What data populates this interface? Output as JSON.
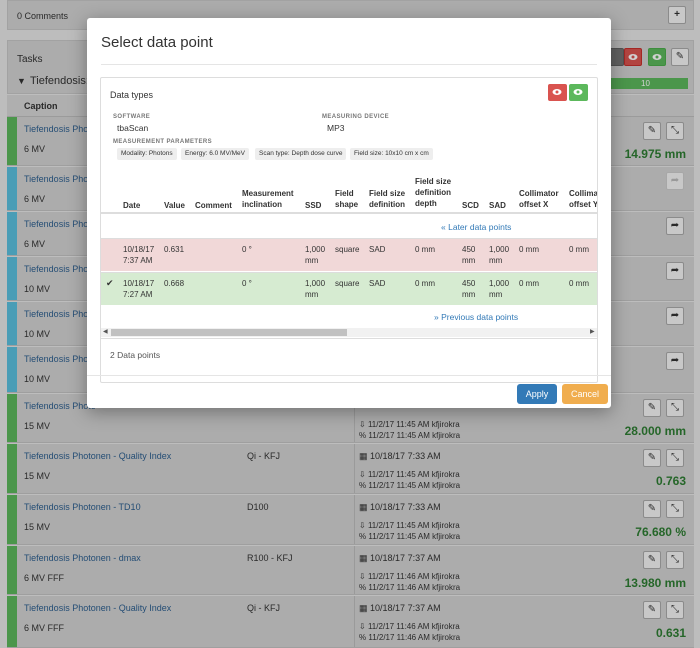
{
  "comments": {
    "count_label": "0 Comments",
    "add_icon": "+"
  },
  "tasks": {
    "title": "Tasks",
    "group_title": "Tiefendosis:",
    "caption_header": "Caption",
    "progress_value": "10",
    "colors": {
      "measured": "#5cb85c",
      "pending": "#5bc0de",
      "danger": "#d9534f",
      "link": "#2d5f8f",
      "value": "#2e7d32"
    }
  },
  "rows": [
    {
      "caption": "Tiefendosis Photo",
      "energy": "6 MV",
      "measurement": "",
      "date": "",
      "uploaded": "",
      "checked": "",
      "value": "14.975 mm",
      "action": "edit"
    },
    {
      "caption": "Tiefendosis Photo",
      "energy": "6 MV",
      "measurement": "",
      "date": "",
      "uploaded": "",
      "checked": "",
      "value": "",
      "action": "share-disabled"
    },
    {
      "caption": "Tiefendosis Photo",
      "energy": "6 MV",
      "measurement": "",
      "date": "",
      "uploaded": "",
      "checked": "",
      "value": "",
      "action": "share"
    },
    {
      "caption": "Tiefendosis Photo",
      "energy": "10 MV",
      "measurement": "",
      "date": "",
      "uploaded": "",
      "checked": "",
      "value": "",
      "action": "share"
    },
    {
      "caption": "Tiefendosis Photo",
      "energy": "10 MV",
      "measurement": "",
      "date": "",
      "uploaded": "",
      "checked": "",
      "value": "",
      "action": "share"
    },
    {
      "caption": "Tiefendosis Photo",
      "energy": "10 MV",
      "measurement": "",
      "date": "",
      "uploaded": "",
      "checked": "",
      "value": "",
      "action": "share"
    },
    {
      "caption": "Tiefendosis Photo",
      "energy": "15 MV",
      "measurement": "",
      "date": "",
      "uploaded": "11/2/17 11:45 AM kfjirokra",
      "checked": "11/2/17 11:45 AM kfjirokra",
      "value": "28.000 mm",
      "action": "edit"
    },
    {
      "caption": "Tiefendosis Photonen - Quality Index",
      "energy": "15 MV",
      "measurement": "Qi - KFJ",
      "date": "10/18/17 7:33 AM",
      "uploaded": "11/2/17 11:45 AM kfjirokra",
      "checked": "11/2/17 11:45 AM kfjirokra",
      "value": "0.763",
      "action": "edit"
    },
    {
      "caption": "Tiefendosis Photonen - TD10",
      "energy": "15 MV",
      "measurement": "D100",
      "date": "10/18/17 7:33 AM",
      "uploaded": "11/2/17 11:45 AM kfjirokra",
      "checked": "11/2/17 11:45 AM kfjirokra",
      "value": "76.680 %",
      "action": "edit"
    },
    {
      "caption": "Tiefendosis Photonen - dmax",
      "energy": "6 MV FFF",
      "measurement": "R100 - KFJ",
      "date": "10/18/17 7:37 AM",
      "uploaded": "11/2/17 11:46 AM kfjirokra",
      "checked": "11/2/17 11:46 AM kfjirokra",
      "value": "13.980 mm",
      "action": "edit"
    },
    {
      "caption": "Tiefendosis Photonen - Quality Index",
      "energy": "6 MV FFF",
      "measurement": "Qi - KFJ",
      "date": "10/18/17 7:37 AM",
      "uploaded": "11/2/17 11:46 AM kfjirokra",
      "checked": "11/2/17 11:46 AM kfjirokra",
      "value": "0.631",
      "action": "edit"
    }
  ],
  "modal": {
    "title": "Select data point",
    "panel_title": "Data types",
    "software_label": "SOFTWARE",
    "software_value": "tbaScan",
    "device_label": "MEASURING DEVICE",
    "device_value": "MP3",
    "params_label": "MEASUREMENT PARAMETERS",
    "params": [
      "Modality: Photons",
      "Energy: 6.0 MV/MeV",
      "Scan type: Depth dose curve",
      "Field size: 10x10 cm x cm"
    ],
    "columns": {
      "date": "Date",
      "value": "Value",
      "comment": "Comment",
      "incl_1": "Measurement",
      "incl_2": "inclination",
      "ssd": "SSD",
      "shape_1": "Field",
      "shape_2": "shape",
      "fsdef_1": "Field size",
      "fsdef_2": "definition",
      "fsdd_1": "Field size",
      "fsdd_2": "definition",
      "fsdd_3": "depth",
      "scd": "SCD",
      "sad": "SAD",
      "collx_1": "Collimator",
      "collx_2": "offset X",
      "colly_1": "Collima",
      "colly_2": "offset Y"
    },
    "later_link": "Later data points",
    "previous_link": "Previous data points",
    "data_points": [
      {
        "date_1": "10/18/17",
        "date_2": "7:37 AM",
        "value": "0.631",
        "comment": "",
        "inclination": "0 °",
        "ssd_1": "1,000",
        "ssd_2": "mm",
        "shape": "square",
        "fs_definition": "SAD",
        "fs_depth": "0 mm",
        "scd_1": "450",
        "scd_2": "mm",
        "sad_1": "1,000",
        "sad_2": "mm",
        "coll_x": "0 mm",
        "coll_y": "0 mm",
        "selected": false
      },
      {
        "date_1": "10/18/17",
        "date_2": "7:27 AM",
        "value": "0.668",
        "comment": "",
        "inclination": "0 °",
        "ssd_1": "1,000",
        "ssd_2": "mm",
        "shape": "square",
        "fs_definition": "SAD",
        "fs_depth": "0 mm",
        "scd_1": "450",
        "scd_2": "mm",
        "sad_1": "1,000",
        "sad_2": "mm",
        "coll_x": "0 mm",
        "coll_y": "0 mm",
        "selected": true
      }
    ],
    "count_label": "2 Data points",
    "apply_label": "Apply",
    "cancel_label": "Cancel",
    "selected_mark": "✔"
  }
}
